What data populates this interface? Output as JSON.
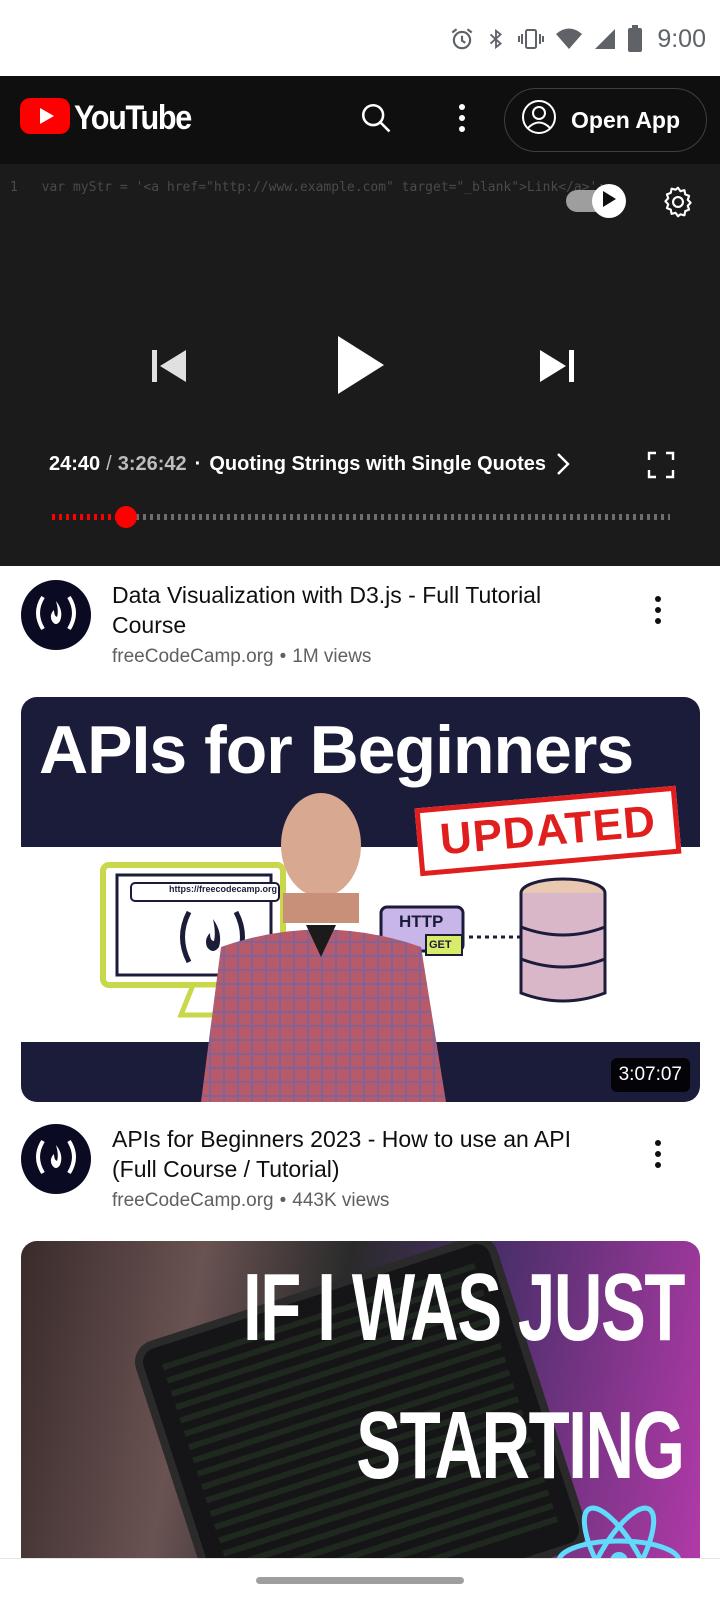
{
  "status_bar": {
    "time": "9:00",
    "icons": [
      "alarm-icon",
      "bluetooth-icon",
      "vibrate-icon",
      "wifi-icon",
      "signal-icon",
      "battery-icon"
    ]
  },
  "app_bar": {
    "logo_text": "YouTube",
    "open_app_label": "Open App",
    "icons": [
      "search-icon",
      "more-vert-icon",
      "account-icon"
    ]
  },
  "player": {
    "code_line_number": "1",
    "code_line": "var myStr = '<a href=\"http://www.example.com\" target=\"_blank\">Link</a>';",
    "autoplay_on": true,
    "current_time": "24:40",
    "separator": "/",
    "duration": "3:26:42",
    "chapter_bullet": "·",
    "chapter_title": "Quoting Strings with Single Quotes",
    "progress_fraction": 0.119,
    "accent_color": "#ff0000"
  },
  "videos": [
    {
      "title": "Data Visualization with D3.js - Full Tutorial Course",
      "channel": "freeCodeCamp.org",
      "bullet": "•",
      "views": "1M views"
    },
    {
      "title": "APIs for Beginners 2023 - How to use an API (Full Course / Tutorial)",
      "channel": "freeCodeCamp.org",
      "bullet": "•",
      "views": "443K views"
    }
  ],
  "thumbnails": [
    {
      "headline": "APIs for Beginners",
      "stamp": "UPDATED",
      "url_text": "https://freecodecamp.org",
      "http_label": "HTTP",
      "get_label": "GET",
      "duration": "3:07:07"
    },
    {
      "line1": "IF I WAS JUST",
      "line2": "STARTING"
    }
  ]
}
